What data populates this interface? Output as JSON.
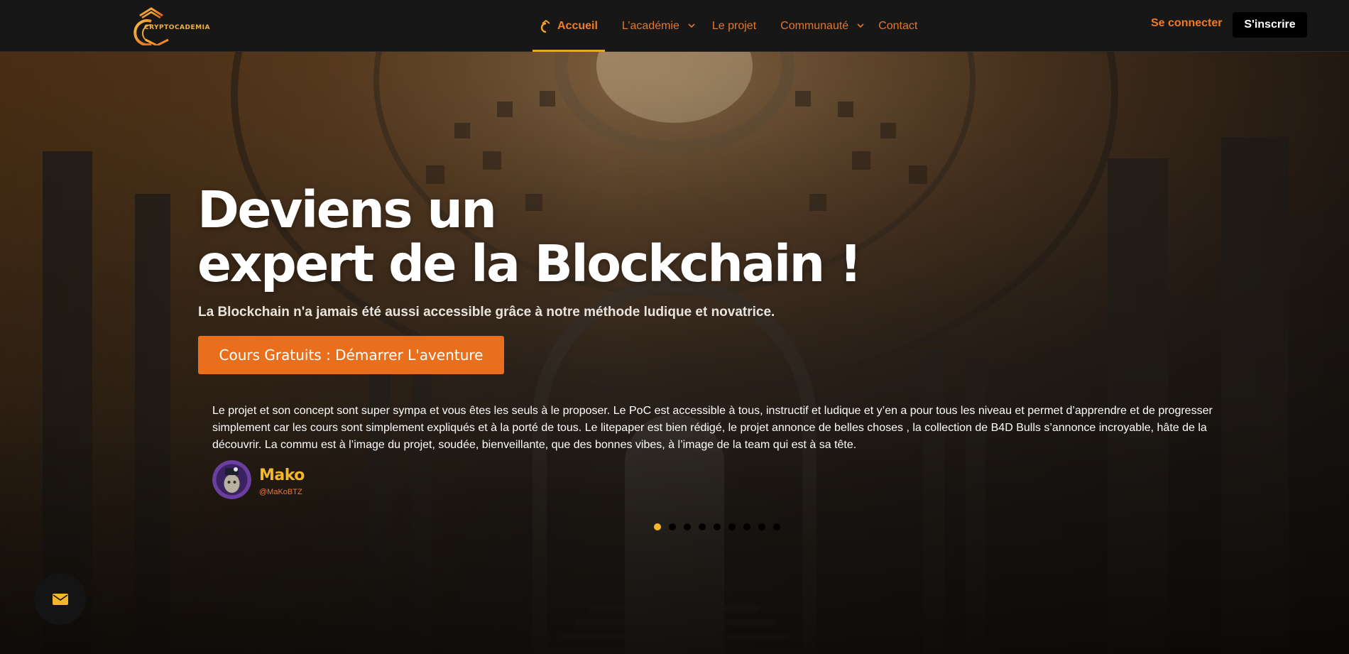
{
  "header": {
    "logo_text": "CRYPTOCADEMIA",
    "nav": [
      {
        "label": "Accueil"
      },
      {
        "label": "L’académie"
      },
      {
        "label": "Le projet"
      },
      {
        "label": "Communauté"
      },
      {
        "label": "Contact"
      }
    ],
    "login_label": "Se connecter",
    "signup_label": "S'inscrire"
  },
  "hero": {
    "title_line1": "Deviens un",
    "title_line2": "expert de la Blockchain !",
    "subtitle": "La Blockchain n'a jamais été aussi accessible grâce à notre méthode ludique et novatrice.",
    "cta_label": "Cours Gratuits : Démarrer L'aventure"
  },
  "testimonial": {
    "text": "Le projet et son concept sont super sympa et vous êtes les seuls à le proposer. Le PoC est accessible à tous, instructif et ludique et y’en a pour tous les niveau et permet d’apprendre et de progresser simplement car les cours sont simplement expliqués et à la porté de tous. Le litepaper est bien rédigé, le projet annonce de belles choses , la collection de B4D Bulls s’annonce incroyable, hâte de la découvrir. La commu est à l’image du projet, soudée, bienveillante, que des bonnes vibes, à l’image de la team qui est à sa tête.",
    "author": "Mako",
    "handle": "@MaKoBTZ"
  },
  "carousel": {
    "total": 9,
    "active_index": 0
  },
  "icons": {
    "home": "logo-mark-icon",
    "chevron": "chevron-down-icon",
    "mail": "envelope-icon"
  },
  "colors": {
    "accent": "#ea6f1d",
    "gold": "#f3b72a",
    "nav_bg": "#171717"
  }
}
